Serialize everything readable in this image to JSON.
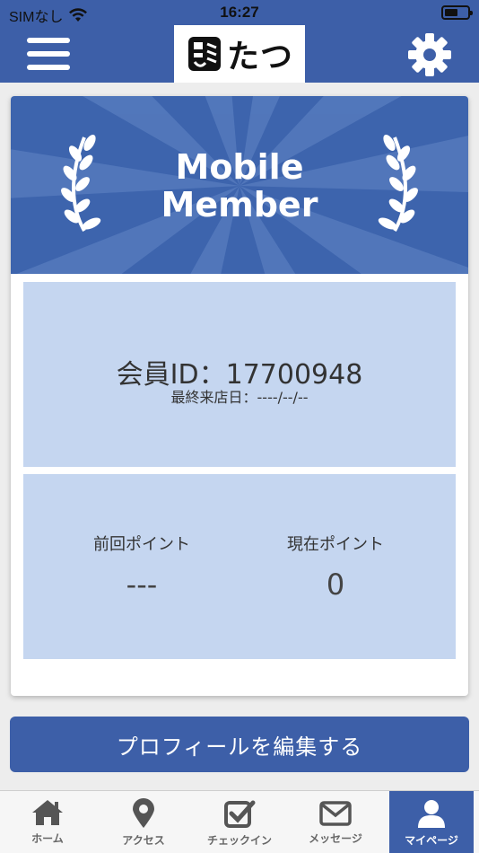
{
  "status_bar": {
    "carrier": "SIMなし",
    "time": "16:27",
    "wifi_icon": "wifi-icon",
    "battery_icon": "battery-icon"
  },
  "header": {
    "menu_icon": "hamburger-menu-icon",
    "logo_text": "たつ",
    "settings_icon": "gear-icon"
  },
  "banner": {
    "line1": "Mobile",
    "line2": "Member",
    "decoration_icon": "laurel-icon"
  },
  "member": {
    "id_label": "会員ID：",
    "id_value": "17700948",
    "last_visit_label": "最終来店日：",
    "last_visit_value": "----/--/--"
  },
  "points": {
    "previous_label": "前回ポイント",
    "previous_value": "---",
    "current_label": "現在ポイント",
    "current_value": "0"
  },
  "edit_profile_button": "プロフィールを編集する",
  "tabs": [
    {
      "label": "ホーム",
      "icon": "home-icon",
      "active": false
    },
    {
      "label": "アクセス",
      "icon": "map-pin-icon",
      "active": false
    },
    {
      "label": "チェックイン",
      "icon": "checkbox-icon",
      "active": false
    },
    {
      "label": "メッセージ",
      "icon": "envelope-icon",
      "active": false
    },
    {
      "label": "マイページ",
      "icon": "user-icon",
      "active": true
    }
  ],
  "colors": {
    "brand_blue": "#3d5fa8",
    "panel_blue": "#c5d6f0"
  }
}
